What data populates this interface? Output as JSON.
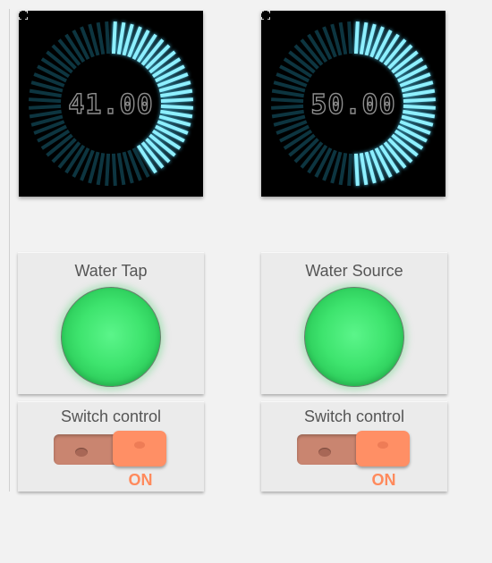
{
  "gauges": [
    {
      "readout": "41.00",
      "value": 41,
      "max": 100
    },
    {
      "readout": "50.00",
      "value": 50,
      "max": 100
    }
  ],
  "indicators": [
    {
      "title": "Water Tap",
      "state_color": "#3ee46e"
    },
    {
      "title": "Water Source",
      "state_color": "#3ee46e"
    }
  ],
  "switches": [
    {
      "title": "Switch control",
      "state": "ON",
      "on": true
    },
    {
      "title": "Switch control",
      "state": "ON",
      "on": true
    }
  ],
  "colors": {
    "gauge_active": "#8ff0ff",
    "gauge_inactive": "#0d3540",
    "switch_on": "#ff8f65"
  },
  "icons": {
    "fullscreen": "expand-corners-icon"
  }
}
